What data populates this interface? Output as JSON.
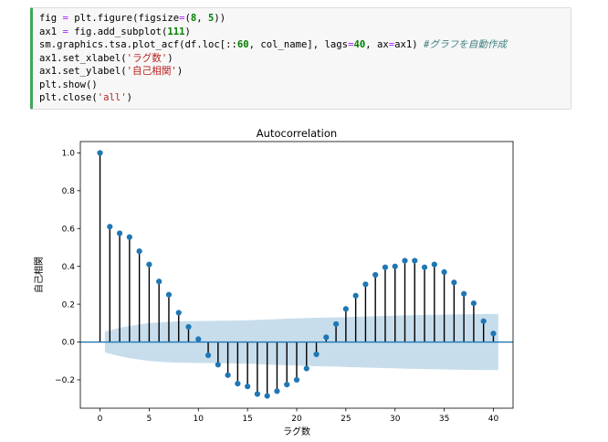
{
  "code_cell": {
    "lines": [
      [
        {
          "t": "fig ",
          "c": ""
        },
        {
          "t": "=",
          "c": "op"
        },
        {
          "t": " plt.figure(figsize",
          "c": ""
        },
        {
          "t": "=",
          "c": "op"
        },
        {
          "t": "(",
          "c": ""
        },
        {
          "t": "8",
          "c": "num"
        },
        {
          "t": ", ",
          "c": ""
        },
        {
          "t": "5",
          "c": "num"
        },
        {
          "t": "))",
          "c": ""
        }
      ],
      [
        {
          "t": "ax1 ",
          "c": ""
        },
        {
          "t": "=",
          "c": "op"
        },
        {
          "t": " fig.add_subplot(",
          "c": ""
        },
        {
          "t": "111",
          "c": "num"
        },
        {
          "t": ")",
          "c": ""
        }
      ],
      [
        {
          "t": "sm.graphics.tsa.plot_acf(df.loc[::",
          "c": ""
        },
        {
          "t": "60",
          "c": "num"
        },
        {
          "t": ", col_name], lags",
          "c": ""
        },
        {
          "t": "=",
          "c": "op"
        },
        {
          "t": "40",
          "c": "num"
        },
        {
          "t": ", ax",
          "c": ""
        },
        {
          "t": "=",
          "c": "op"
        },
        {
          "t": "ax1) ",
          "c": ""
        },
        {
          "t": "#グラフを自動作成",
          "c": "cmt"
        }
      ],
      [
        {
          "t": "ax1.set_xlabel(",
          "c": ""
        },
        {
          "t": "'ラグ数'",
          "c": "str"
        },
        {
          "t": ")",
          "c": ""
        }
      ],
      [
        {
          "t": "ax1.set_ylabel(",
          "c": ""
        },
        {
          "t": "'自己相関'",
          "c": "str"
        },
        {
          "t": ")",
          "c": ""
        }
      ],
      [
        {
          "t": "plt.show()",
          "c": ""
        }
      ],
      [
        {
          "t": "plt.close(",
          "c": ""
        },
        {
          "t": "'all'",
          "c": "str"
        },
        {
          "t": ")",
          "c": ""
        }
      ]
    ]
  },
  "chart_data": {
    "type": "scatter",
    "title": "Autocorrelation",
    "xlabel": "ラグ数",
    "ylabel": "自己相関",
    "xlim": [
      -2,
      42
    ],
    "ylim": [
      -0.35,
      1.06
    ],
    "xticks": [
      0,
      5,
      10,
      15,
      20,
      25,
      30,
      35,
      40
    ],
    "yticks": [
      -0.2,
      0.0,
      0.2,
      0.4,
      0.6,
      0.8,
      1.0
    ],
    "ytick_labels": [
      "−0.2",
      "0.0",
      "0.2",
      "0.4",
      "0.6",
      "0.8",
      "1.0"
    ],
    "lags": [
      0,
      1,
      2,
      3,
      4,
      5,
      6,
      7,
      8,
      9,
      10,
      11,
      12,
      13,
      14,
      15,
      16,
      17,
      18,
      19,
      20,
      21,
      22,
      23,
      24,
      25,
      26,
      27,
      28,
      29,
      30,
      31,
      32,
      33,
      34,
      35,
      36,
      37,
      38,
      39,
      40
    ],
    "acf": [
      1.0,
      0.61,
      0.575,
      0.555,
      0.48,
      0.41,
      0.32,
      0.25,
      0.155,
      0.08,
      0.015,
      -0.07,
      -0.12,
      -0.175,
      -0.22,
      -0.235,
      -0.275,
      -0.285,
      -0.26,
      -0.225,
      -0.2,
      -0.14,
      -0.065,
      0.025,
      0.095,
      0.175,
      0.245,
      0.305,
      0.355,
      0.395,
      0.4,
      0.43,
      0.43,
      0.395,
      0.41,
      0.37,
      0.315,
      0.255,
      0.205,
      0.11,
      0.045
    ],
    "confint_upper": [
      0.0,
      0.055,
      0.075,
      0.085,
      0.093,
      0.1,
      0.104,
      0.107,
      0.109,
      0.11,
      0.111,
      0.111,
      0.112,
      0.113,
      0.114,
      0.115,
      0.117,
      0.119,
      0.121,
      0.123,
      0.125,
      0.126,
      0.128,
      0.129,
      0.13,
      0.132,
      0.133,
      0.135,
      0.136,
      0.138,
      0.139,
      0.141,
      0.142,
      0.143,
      0.144,
      0.145,
      0.146,
      0.147,
      0.147,
      0.148,
      0.148
    ],
    "colors": {
      "marker": "#1f77b4",
      "stem": "#000000",
      "baseline": "#1f77b4",
      "band": "#1f77b4"
    }
  }
}
